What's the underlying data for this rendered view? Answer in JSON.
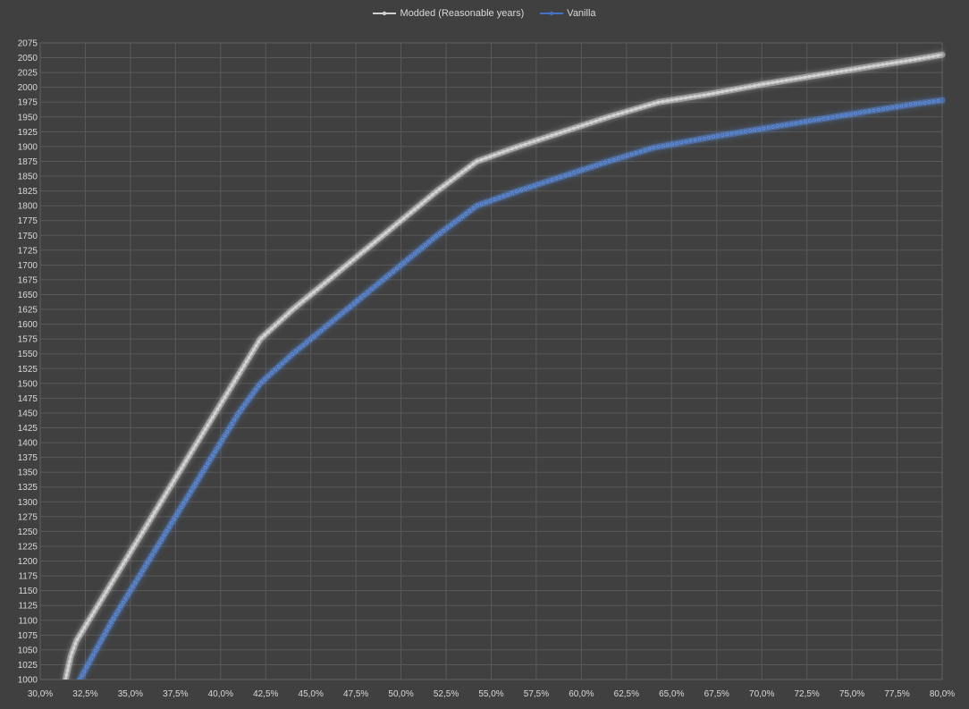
{
  "chart_data": {
    "type": "line",
    "title": "",
    "xlabel": "",
    "ylabel": "",
    "xlim": [
      30.0,
      80.0
    ],
    "ylim": [
      1000,
      2075
    ],
    "x_step": 2.5,
    "y_step": 25,
    "grid": true,
    "legend_position": "top-center",
    "x_tick_labels": [
      "30,0%",
      "32,5%",
      "35,0%",
      "37,5%",
      "40,0%",
      "42,5%",
      "45,0%",
      "47,5%",
      "50,0%",
      "52,5%",
      "55,0%",
      "57,5%",
      "60,0%",
      "62,5%",
      "65,0%",
      "67,5%",
      "70,0%",
      "72,5%",
      "75,0%",
      "77,5%",
      "80,0%"
    ],
    "series": [
      {
        "name": "Modded (Reasonable years)",
        "color": "#d0d0d0",
        "glow": "#ffffff",
        "x": [
          31.4,
          31.7,
          32.0,
          32.3,
          33.0,
          34.0,
          35.0,
          36.0,
          37.5,
          39.0,
          40.5,
          42.2,
          44.0,
          46.0,
          48.0,
          50.0,
          52.0,
          54.2,
          56.5,
          59.0,
          61.5,
          64.3,
          67.0,
          70.0,
          73.0,
          76.0,
          78.5,
          80.0
        ],
        "y": [
          1000,
          1040,
          1065,
          1080,
          1115,
          1165,
          1215,
          1265,
          1340,
          1415,
          1490,
          1575,
          1625,
          1675,
          1725,
          1775,
          1825,
          1875,
          1900,
          1925,
          1950,
          1975,
          1988,
          2005,
          2020,
          2035,
          2047,
          2055
        ]
      },
      {
        "name": "Vanilla",
        "color": "#4472c4",
        "glow": "#5b9bff",
        "x": [
          32.2,
          33.0,
          34.0,
          35.0,
          36.5,
          38.0,
          39.5,
          41.0,
          42.2,
          44.0,
          46.0,
          48.0,
          50.0,
          52.0,
          54.2,
          56.5,
          59.0,
          61.5,
          64.0,
          67.0,
          70.0,
          73.0,
          76.0,
          78.5,
          80.0
        ],
        "y": [
          1000,
          1045,
          1100,
          1150,
          1225,
          1300,
          1375,
          1450,
          1500,
          1550,
          1600,
          1650,
          1700,
          1750,
          1800,
          1825,
          1850,
          1875,
          1898,
          1915,
          1930,
          1945,
          1960,
          1972,
          1978
        ]
      }
    ]
  }
}
